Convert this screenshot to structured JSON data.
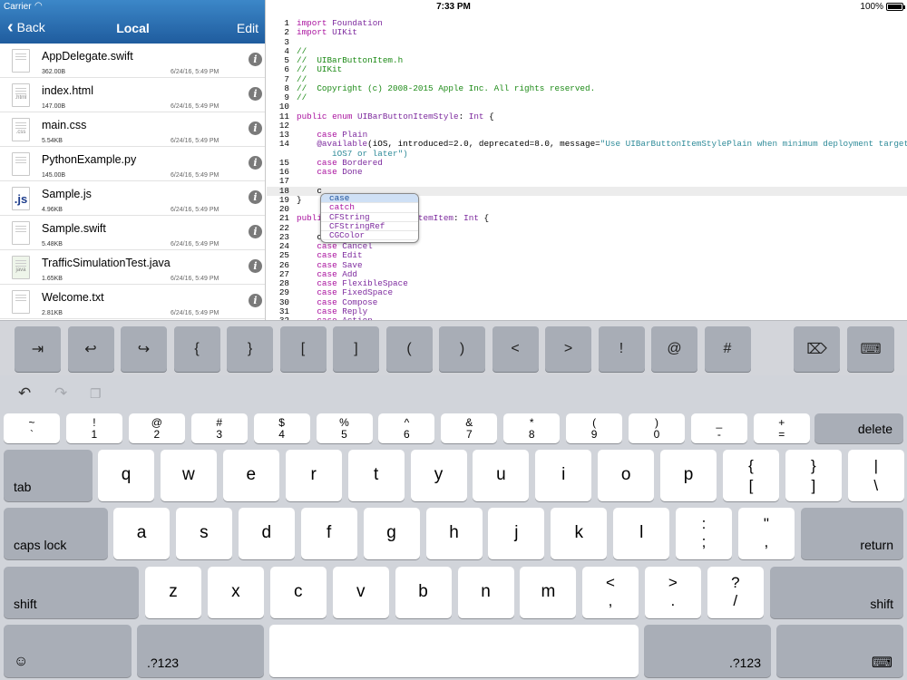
{
  "status": {
    "carrier": "Carrier",
    "time": "7:33 PM",
    "battery": "100%"
  },
  "nav": {
    "back": "Back",
    "title": "Local",
    "edit": "Edit"
  },
  "files": [
    {
      "name": "AppDelegate.swift",
      "size": "362.00B",
      "date": "6/24/16, 5:49 PM",
      "icon": "swift-file-icon"
    },
    {
      "name": "index.html",
      "size": "147.00B",
      "date": "6/24/16, 5:49 PM",
      "icon": "html-file-icon",
      "tag": ".html"
    },
    {
      "name": "main.css",
      "size": "5.54KB",
      "date": "6/24/16, 5:49 PM",
      "icon": "css-file-icon",
      "tag": ".css"
    },
    {
      "name": "PythonExample.py",
      "size": "145.00B",
      "date": "6/24/16, 5:49 PM",
      "icon": "python-file-icon"
    },
    {
      "name": "Sample.js",
      "size": "4.96KB",
      "date": "6/24/16, 5:49 PM",
      "icon": "js-file-icon",
      "tag": ".js"
    },
    {
      "name": "Sample.swift",
      "size": "5.48KB",
      "date": "6/24/16, 5:49 PM",
      "icon": "swift-file-icon"
    },
    {
      "name": "TrafficSimulationTest.java",
      "size": "1.65KB",
      "date": "6/24/16, 5:49 PM",
      "icon": "java-file-icon",
      "tag": "java"
    },
    {
      "name": "Welcome.txt",
      "size": "2.81KB",
      "date": "6/24/16, 5:49 PM",
      "icon": "text-file-icon"
    }
  ],
  "code_lines": [
    [
      [
        "kw",
        "import"
      ],
      [
        "p",
        " "
      ],
      [
        "ty",
        "Foundation"
      ]
    ],
    [
      [
        "kw",
        "import"
      ],
      [
        "p",
        " "
      ],
      [
        "ty",
        "UIKit"
      ]
    ],
    [],
    [
      [
        "cm",
        "//"
      ]
    ],
    [
      [
        "cm",
        "//  UIBarButtonItem.h"
      ]
    ],
    [
      [
        "cm",
        "//  UIKit"
      ]
    ],
    [
      [
        "cm",
        "//"
      ]
    ],
    [
      [
        "cm",
        "//  Copyright (c) 2008-2015 Apple Inc. All rights reserved."
      ]
    ],
    [
      [
        "cm",
        "//"
      ]
    ],
    [],
    [
      [
        "kw",
        "public"
      ],
      [
        "p",
        " "
      ],
      [
        "kw",
        "enum"
      ],
      [
        "p",
        " "
      ],
      [
        "ty",
        "UIBarButtonItemStyle"
      ],
      [
        "p",
        ": "
      ],
      [
        "ty",
        "Int"
      ],
      [
        "p",
        " {"
      ]
    ],
    [],
    [
      [
        "p",
        "    "
      ],
      [
        "kw",
        "case"
      ],
      [
        "p",
        " "
      ],
      [
        "ty",
        "Plain"
      ]
    ],
    [
      [
        "p",
        "    "
      ],
      [
        "at",
        "@available"
      ],
      [
        "p",
        "(iOS, introduced=2.0, deprecated=8.0, message="
      ],
      [
        "st",
        "\"Use UIBarButtonItemStylePlain when minimum deployment target is"
      ]
    ],
    [
      [
        "p",
        "    "
      ],
      [
        "kw",
        "case"
      ],
      [
        "p",
        " "
      ],
      [
        "ty",
        "Bordered"
      ]
    ],
    [
      [
        "p",
        "    "
      ],
      [
        "kw",
        "case"
      ],
      [
        "p",
        " "
      ],
      [
        "ty",
        "Done"
      ]
    ],
    [],
    [
      [
        "p",
        "    c"
      ]
    ],
    [
      [
        "p",
        "}"
      ]
    ],
    [],
    [
      [
        "kw",
        "publi"
      ],
      [
        "p",
        "                   "
      ],
      [
        "ty",
        "temItem"
      ],
      [
        "p",
        ": "
      ],
      [
        "ty",
        "Int"
      ],
      [
        "p",
        " {"
      ]
    ],
    [],
    [
      [
        "p",
        "    c"
      ]
    ],
    [
      [
        "p",
        "    "
      ],
      [
        "kw",
        "case"
      ],
      [
        "p",
        " "
      ],
      [
        "ty",
        "Cancel"
      ]
    ],
    [
      [
        "p",
        "    "
      ],
      [
        "kw",
        "case"
      ],
      [
        "p",
        " "
      ],
      [
        "ty",
        "Edit"
      ]
    ],
    [
      [
        "p",
        "    "
      ],
      [
        "kw",
        "case"
      ],
      [
        "p",
        " "
      ],
      [
        "ty",
        "Save"
      ]
    ],
    [
      [
        "p",
        "    "
      ],
      [
        "kw",
        "case"
      ],
      [
        "p",
        " "
      ],
      [
        "ty",
        "Add"
      ]
    ],
    [
      [
        "p",
        "    "
      ],
      [
        "kw",
        "case"
      ],
      [
        "p",
        " "
      ],
      [
        "ty",
        "FlexibleSpace"
      ]
    ],
    [
      [
        "p",
        "    "
      ],
      [
        "kw",
        "case"
      ],
      [
        "p",
        " "
      ],
      [
        "ty",
        "FixedSpace"
      ]
    ],
    [
      [
        "p",
        "    "
      ],
      [
        "kw",
        "case"
      ],
      [
        "p",
        " "
      ],
      [
        "ty",
        "Compose"
      ]
    ],
    [
      [
        "p",
        "    "
      ],
      [
        "kw",
        "case"
      ],
      [
        "p",
        " "
      ],
      [
        "ty",
        "Reply"
      ]
    ],
    [
      [
        "p",
        "    "
      ],
      [
        "kw",
        "case"
      ],
      [
        "p",
        " "
      ],
      [
        "ty",
        "Action"
      ]
    ]
  ],
  "wrapped_line": "       iOS7 or later\")",
  "line_numbers": [
    "1",
    "2",
    "3",
    "4",
    "5",
    "6",
    "7",
    "8",
    "9",
    "10",
    "11",
    "12",
    "13",
    "14",
    "15",
    "16",
    "17",
    "18",
    "19",
    "20",
    "21",
    "22",
    "23",
    "24",
    "25",
    "26",
    "27",
    "28",
    "29",
    "30",
    "31",
    "32"
  ],
  "autocomplete": [
    "case",
    "catch",
    "CFString",
    "CFStringRef",
    "CGColor"
  ],
  "extra_keys": [
    "⇥",
    "↩",
    "↪",
    "{",
    "}",
    "[",
    "]",
    "(",
    ")",
    "<",
    ">",
    "!",
    "@",
    "#"
  ],
  "keyboard": {
    "row1": [
      [
        "~",
        "`"
      ],
      [
        "!",
        "1"
      ],
      [
        "@",
        "2"
      ],
      [
        "#",
        "3"
      ],
      [
        "$",
        "4"
      ],
      [
        "%",
        "5"
      ],
      [
        "^",
        "6"
      ],
      [
        "&",
        "7"
      ],
      [
        "*",
        "8"
      ],
      [
        "(",
        "9"
      ],
      [
        ")",
        "0"
      ],
      [
        "_",
        "-"
      ],
      [
        "+",
        "="
      ]
    ],
    "row2": [
      "q",
      "w",
      "e",
      "r",
      "t",
      "y",
      "u",
      "i",
      "o",
      "p"
    ],
    "row2_sym": [
      [
        "{",
        "["
      ],
      [
        "}",
        "]"
      ],
      [
        "|",
        "\\"
      ]
    ],
    "row3": [
      "a",
      "s",
      "d",
      "f",
      "g",
      "h",
      "j",
      "k",
      "l"
    ],
    "row3_sym": [
      [
        ":",
        ";"
      ],
      [
        "\"",
        ","
      ]
    ],
    "row4": [
      "z",
      "x",
      "c",
      "v",
      "b",
      "n",
      "m"
    ],
    "row4_sym": [
      [
        "<",
        ","
      ],
      [
        ">",
        "."
      ],
      [
        "?",
        "/"
      ]
    ],
    "delete": "delete",
    "tab": "tab",
    "caps": "caps lock",
    "return": "return",
    "shift": "shift",
    "num": ".?123"
  }
}
